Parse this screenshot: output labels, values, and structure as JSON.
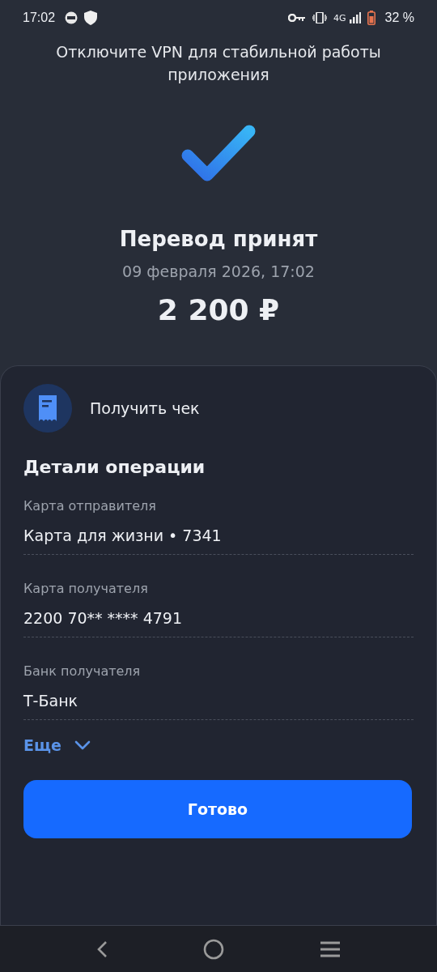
{
  "status_bar": {
    "time": "17:02",
    "network": "4G",
    "battery": "32 %"
  },
  "banner": "Отключите VPN для стабильной работы приложения",
  "result": {
    "title": "Перевод принят",
    "date": "09 февраля 2026, 17:02",
    "amount": "2 200 ₽"
  },
  "receipt": {
    "label": "Получить чек"
  },
  "details": {
    "title": "Детали операции",
    "fields": [
      {
        "label": "Карта отправителя",
        "value": "Карта для жизни • 7341"
      },
      {
        "label": "Карта получателя",
        "value": "2200 70** **** 4791"
      },
      {
        "label": "Банк получателя",
        "value": "Т-Банк"
      }
    ],
    "more": {
      "label": "Еще",
      "expanded": false
    }
  },
  "done_button": "Готово"
}
